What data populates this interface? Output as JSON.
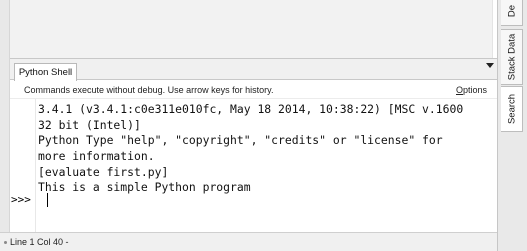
{
  "tabs": {
    "python_shell": "Python Shell"
  },
  "hint": {
    "text": "Commands execute without debug.  Use arrow keys for history.",
    "options_label": "Options"
  },
  "shell": {
    "prompt": ">>>",
    "lines": [
      "3.4.1 (v3.4.1:c0e311e010fc, May 18 2014, 10:38:22) [MSC v.1600",
      "32 bit (Intel)]",
      "Python Type \"help\", \"copyright\", \"credits\" or \"license\" for",
      "more information.",
      "[evaluate first.py]",
      "This is a simple Python program"
    ]
  },
  "status": {
    "position": "Line 1 Col 40 -"
  },
  "side_tabs": {
    "debug": "De",
    "stack_data": "Stack Data",
    "search": "Search"
  }
}
